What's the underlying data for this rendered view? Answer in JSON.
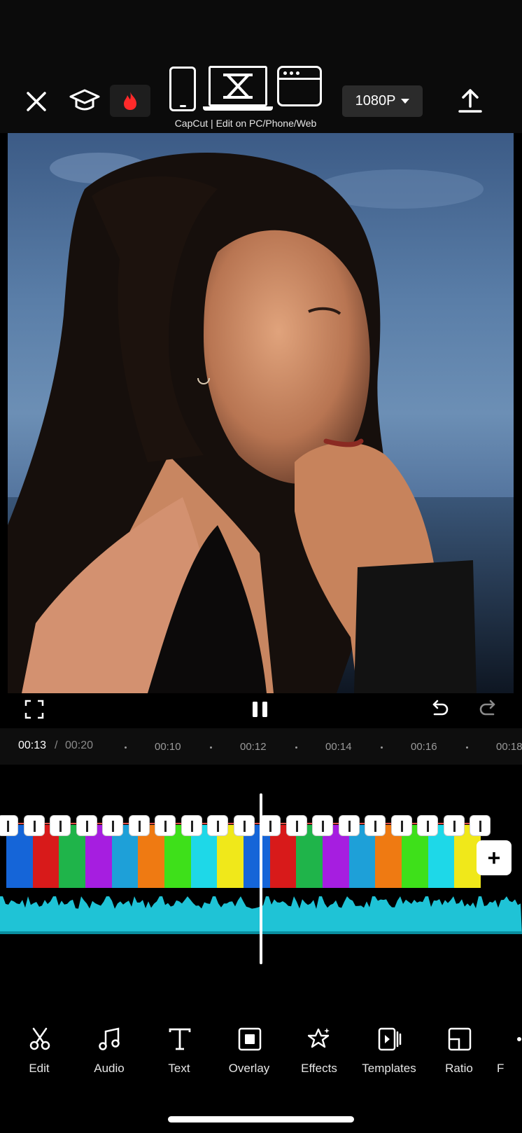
{
  "header": {
    "device_caption": "CapCut | Edit on PC/Phone/Web",
    "resolution": "1080P",
    "icons": [
      "close-icon",
      "learn-cap-icon",
      "hot-flame-icon",
      "phone-icon",
      "laptop-capcut-icon",
      "browser-icon",
      "chevron-down-icon",
      "export-upload-icon"
    ]
  },
  "player": {
    "icons": [
      "fullscreen-icon",
      "pause-icon",
      "undo-icon",
      "redo-icon"
    ]
  },
  "ruler": {
    "current": "00:13",
    "separator": "/",
    "total": "00:20",
    "ticks": [
      "00:10",
      "00:12",
      "00:14",
      "00:16",
      "00:18"
    ]
  },
  "timeline": {
    "add_label": "+",
    "clip_colors": [
      "#1565d8",
      "#d81a1a",
      "#1fb44a",
      "#a61ee0",
      "#1ea0d8",
      "#ef7a12",
      "#3ee01a",
      "#1ed8e8",
      "#f0e81a",
      "#1565d8",
      "#d81a1a",
      "#1fb44a",
      "#a61ee0",
      "#1ea0d8",
      "#ef7a12",
      "#3ee01a",
      "#1ed8e8",
      "#f0e81a"
    ],
    "audio_color": "#1fc3d6"
  },
  "toolbar": {
    "items": [
      {
        "label": "Edit",
        "icon": "scissors-icon"
      },
      {
        "label": "Audio",
        "icon": "music-note-icon"
      },
      {
        "label": "Text",
        "icon": "text-icon"
      },
      {
        "label": "Overlay",
        "icon": "overlay-icon"
      },
      {
        "label": "Effects",
        "icon": "effects-star-icon"
      },
      {
        "label": "Templates",
        "icon": "templates-icon"
      },
      {
        "label": "Ratio",
        "icon": "ratio-icon"
      },
      {
        "label": "F",
        "icon": "more-icon"
      }
    ]
  }
}
